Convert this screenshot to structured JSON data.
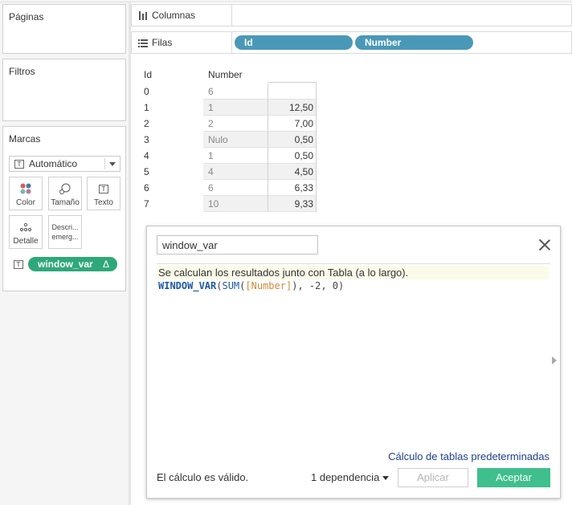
{
  "left_panel": {
    "paginas_title": "Páginas",
    "filtros_title": "Filtros",
    "marcas_title": "Marcas",
    "mark_type": "Automático",
    "mark_buttons": {
      "color": "Color",
      "tamano": "Tamaño",
      "texto": "Texto",
      "detalle": "Detalle",
      "descr_line1": "Descri...",
      "descr_line2": "emerg..."
    },
    "mark_pill": "window_var",
    "mark_pill_delta": "Δ"
  },
  "shelves": {
    "columnas_label": "Columnas",
    "filas_label": "Filas",
    "filas_pills": [
      "Id",
      "Number"
    ]
  },
  "table": {
    "headers": [
      "Id",
      "Number"
    ],
    "rows": [
      {
        "id": "0",
        "number": "6",
        "value": ""
      },
      {
        "id": "1",
        "number": "1",
        "value": "12,50"
      },
      {
        "id": "2",
        "number": "2",
        "value": "7,00"
      },
      {
        "id": "3",
        "number": "Nulo",
        "value": "0,50"
      },
      {
        "id": "4",
        "number": "1",
        "value": "0,50"
      },
      {
        "id": "5",
        "number": "4",
        "value": "4,50"
      },
      {
        "id": "6",
        "number": "6",
        "value": "6,33"
      },
      {
        "id": "7",
        "number": "10",
        "value": "9,33"
      }
    ]
  },
  "dialog": {
    "calc_name": "window_var",
    "info": "Se calculan los resultados junto con Tabla (a lo largo).",
    "formula": {
      "fn": "WINDOW_VAR",
      "p1": "(",
      "fn2": "SUM",
      "p2": "(",
      "field": "[Number]",
      "rest": "), -2, 0)"
    },
    "default_link": "Cálculo de tablas predeterminadas",
    "valid": "El cálculo es válido.",
    "dependency": "1 dependencia",
    "apply": "Aplicar",
    "accept": "Aceptar"
  }
}
